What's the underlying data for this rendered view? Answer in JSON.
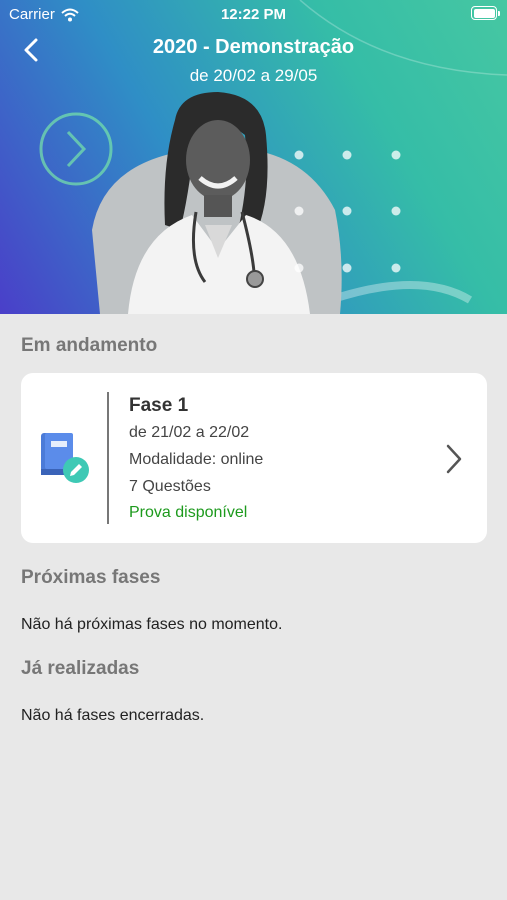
{
  "status_bar": {
    "carrier": "Carrier",
    "time": "12:22 PM"
  },
  "header": {
    "title": "2020 - Demonstração",
    "subtitle": "de 20/02 a 29/05"
  },
  "sections": {
    "in_progress": {
      "title": "Em andamento",
      "card": {
        "name": "Fase 1",
        "dates": "de 21/02 a 22/02",
        "modality": "Modalidade: online",
        "questions": "7 Questões",
        "status": "Prova disponível"
      }
    },
    "upcoming": {
      "title": "Próximas fases",
      "empty_message": "Não há próximas fases no momento."
    },
    "completed": {
      "title": "Já realizadas",
      "empty_message": "Não há fases encerradas."
    }
  },
  "colors": {
    "accent_green": "#1d9a1d",
    "gradient_start": "#4a3fc9",
    "gradient_end": "#46c7a2",
    "book_blue": "#4b7bd8",
    "pencil_teal": "#3ec9b5"
  },
  "icons": {
    "back": "chevron-left-icon",
    "wifi": "wifi-icon",
    "battery": "battery-icon",
    "phase": "book-pencil-icon",
    "open": "chevron-right-icon"
  }
}
